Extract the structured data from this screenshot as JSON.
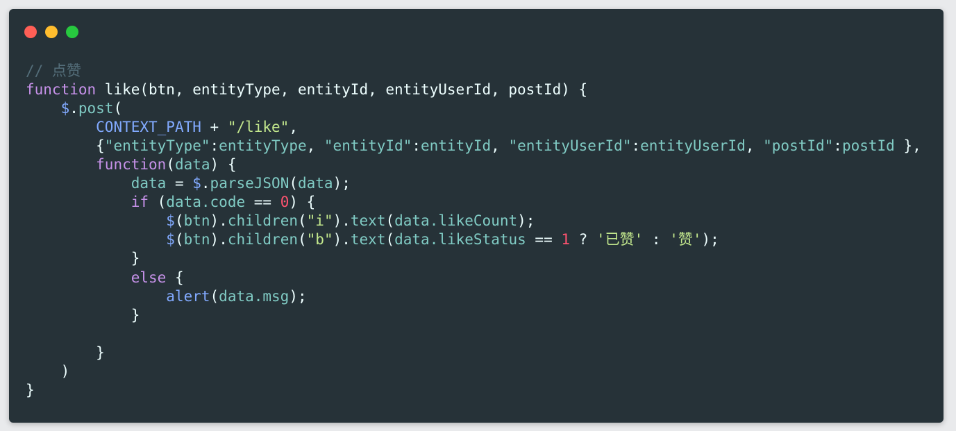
{
  "colors": {
    "background": "#263238",
    "keyword": "#c792ea",
    "function": "#82aaff",
    "variable": "#80cbc4",
    "string": "#c3e88d",
    "number": "#ff5370",
    "comment": "#546e7a",
    "text": "#eeffff"
  },
  "window_controls": [
    "close",
    "minimize",
    "maximize"
  ],
  "code_lines": [
    [
      [
        "// 点赞",
        "cm"
      ]
    ],
    [
      [
        "function",
        "kw"
      ],
      [
        " like(btn, entityType, entityId, entityUserId, postId) {",
        "pl"
      ]
    ],
    [
      [
        "    $",
        "fn"
      ],
      [
        ".",
        "pl"
      ],
      [
        "post",
        "var"
      ],
      [
        "(",
        "pl"
      ]
    ],
    [
      [
        "        ",
        "pl"
      ],
      [
        "CONTEXT_PATH",
        "fn"
      ],
      [
        " + ",
        "pl"
      ],
      [
        "\"/like\"",
        "str"
      ],
      [
        ",",
        "pl"
      ]
    ],
    [
      [
        "        {",
        "pl"
      ],
      [
        "\"entityType\"",
        "key"
      ],
      [
        ":",
        "pl"
      ],
      [
        "entityType",
        "var"
      ],
      [
        ", ",
        "pl"
      ],
      [
        "\"entityId\"",
        "key"
      ],
      [
        ":",
        "pl"
      ],
      [
        "entityId",
        "var"
      ],
      [
        ", ",
        "pl"
      ],
      [
        "\"entityUserId\"",
        "key"
      ],
      [
        ":",
        "pl"
      ],
      [
        "entityUserId",
        "var"
      ],
      [
        ", ",
        "pl"
      ],
      [
        "\"postId\"",
        "key"
      ],
      [
        ":",
        "pl"
      ],
      [
        "postId",
        "var"
      ],
      [
        " },",
        "pl"
      ]
    ],
    [
      [
        "        ",
        "pl"
      ],
      [
        "function",
        "kw"
      ],
      [
        "(",
        "pl"
      ],
      [
        "data",
        "var"
      ],
      [
        ") {",
        "pl"
      ]
    ],
    [
      [
        "            ",
        "pl"
      ],
      [
        "data",
        "var"
      ],
      [
        " = ",
        "pl"
      ],
      [
        "$",
        "fn"
      ],
      [
        ".",
        "pl"
      ],
      [
        "parseJSON",
        "var"
      ],
      [
        "(",
        "pl"
      ],
      [
        "data",
        "var"
      ],
      [
        ");",
        "pl"
      ]
    ],
    [
      [
        "            ",
        "pl"
      ],
      [
        "if",
        "kw"
      ],
      [
        " (",
        "pl"
      ],
      [
        "data.code",
        "var"
      ],
      [
        " == ",
        "pl"
      ],
      [
        "0",
        "num"
      ],
      [
        ") {",
        "pl"
      ]
    ],
    [
      [
        "                ",
        "pl"
      ],
      [
        "$",
        "fn"
      ],
      [
        "(",
        "pl"
      ],
      [
        "btn",
        "var"
      ],
      [
        ").",
        "pl"
      ],
      [
        "children",
        "var"
      ],
      [
        "(",
        "pl"
      ],
      [
        "\"i\"",
        "str"
      ],
      [
        ").",
        "pl"
      ],
      [
        "text",
        "var"
      ],
      [
        "(",
        "pl"
      ],
      [
        "data.likeCount",
        "var"
      ],
      [
        ");",
        "pl"
      ]
    ],
    [
      [
        "                ",
        "pl"
      ],
      [
        "$",
        "fn"
      ],
      [
        "(",
        "pl"
      ],
      [
        "btn",
        "var"
      ],
      [
        ").",
        "pl"
      ],
      [
        "children",
        "var"
      ],
      [
        "(",
        "pl"
      ],
      [
        "\"b\"",
        "str"
      ],
      [
        ").",
        "pl"
      ],
      [
        "text",
        "var"
      ],
      [
        "(",
        "pl"
      ],
      [
        "data.likeStatus",
        "var"
      ],
      [
        " == ",
        "pl"
      ],
      [
        "1",
        "num"
      ],
      [
        " ? ",
        "pl"
      ],
      [
        "'已赞'",
        "str"
      ],
      [
        " : ",
        "pl"
      ],
      [
        "'赞'",
        "str"
      ],
      [
        ");",
        "pl"
      ]
    ],
    [
      [
        "            }",
        "pl"
      ]
    ],
    [
      [
        "            ",
        "pl"
      ],
      [
        "else",
        "kw"
      ],
      [
        " {",
        "pl"
      ]
    ],
    [
      [
        "                ",
        "pl"
      ],
      [
        "alert",
        "fn"
      ],
      [
        "(",
        "pl"
      ],
      [
        "data.msg",
        "var"
      ],
      [
        ");",
        "pl"
      ]
    ],
    [
      [
        "            }",
        "pl"
      ]
    ],
    [
      [
        "",
        "pl"
      ]
    ],
    [
      [
        "        }",
        "pl"
      ]
    ],
    [
      [
        "    )",
        "pl"
      ]
    ],
    [
      [
        "}",
        "pl"
      ]
    ]
  ]
}
